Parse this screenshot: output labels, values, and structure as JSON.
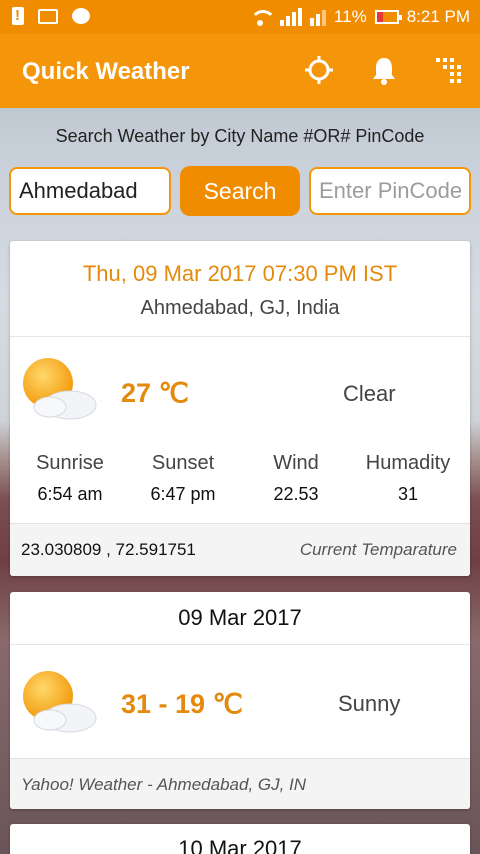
{
  "status_bar": {
    "battery_pct": "11%",
    "time": "8:21 PM",
    "colors": {
      "bar": "#f08c00",
      "battery_low": "#e53935"
    }
  },
  "app_bar": {
    "title": "Quick Weather",
    "actions": [
      "locate-icon",
      "bell-icon",
      "grid-menu-icon"
    ],
    "color": "#f5960a"
  },
  "search": {
    "hint": "Search Weather by City Name #OR# PinCode",
    "city_value": "Ahmedabad",
    "button_label": "Search",
    "pincode_placeholder": "Enter PinCode"
  },
  "current": {
    "datetime": "Thu, 09 Mar 2017 07:30 PM IST",
    "location": "Ahmedabad,  GJ, India",
    "temp": "27 ℃",
    "condition": "Clear",
    "stats": [
      {
        "label": "Sunrise",
        "value": "6:54 am"
      },
      {
        "label": "Sunset",
        "value": "6:47 pm"
      },
      {
        "label": "Wind",
        "value": "22.53"
      },
      {
        "label": "Humadity",
        "value": "31"
      }
    ],
    "coords": "23.030809 , 72.591751",
    "footer_label": "Current Temparature",
    "accent": "#e38a0c"
  },
  "forecast": [
    {
      "date": "09 Mar 2017",
      "range": "31 - 19 ℃",
      "condition": "Sunny",
      "source": "Yahoo! Weather - Ahmedabad, GJ, IN"
    },
    {
      "date": "10 Mar 2017"
    }
  ]
}
